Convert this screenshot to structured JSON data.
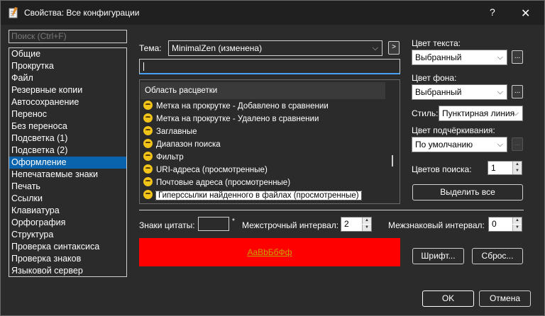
{
  "window": {
    "title": "Свойства: Все конфигурации",
    "help": "?",
    "close": "✕"
  },
  "search": {
    "placeholder": "Поиск (Ctrl+F)"
  },
  "nav": {
    "items": [
      "Общие",
      "Прокрутка",
      "Файл",
      "Резервные копии",
      "Автосохранение",
      "Перенос",
      "Без переноса",
      "Подсветка (1)",
      "Подсветка (2)",
      "Оформление",
      "Непечатаемые знаки",
      "Печать",
      "Ссылки",
      "Клавиатура",
      "Орфография",
      "Структура",
      "Проверка синтаксиса",
      "Проверка знаков",
      "Языковой сервер"
    ],
    "selected_index": 9
  },
  "theme": {
    "label": "Тема:",
    "value": "MinimalZen (изменена)",
    "arrow_button": ">"
  },
  "filter_input": {
    "value": ""
  },
  "color_list": {
    "header": "Область расцветки",
    "items": [
      "Метка на прокрутке - Добавлено в сравнении",
      "Метка на прокрутке - Удалено в сравнении",
      "Заглавные",
      "Диапазон поиска",
      "Фильтр",
      "URI-адреса (просмотренные)",
      "Почтовые адреса (просмотренные)",
      "Гиперссылки найденного в файлах (просмотренные)"
    ],
    "selected_index": 7
  },
  "right": {
    "text_color_label": "Цвет текста:",
    "text_color_value": "Выбранный",
    "bg_color_label": "Цвет фона:",
    "bg_color_value": "Выбранный",
    "ellipsis": "...",
    "style_label": "Стиль:",
    "style_value": "Пунктирная линия",
    "underline_label": "Цвет подчёркивания:",
    "underline_value": "По умолчанию",
    "search_colors_label": "Цветов поиска:",
    "search_colors_value": "1",
    "select_all": "Выделить все"
  },
  "bottom_row": {
    "quote_label": "Знаки цитаты:",
    "quote_star": "*",
    "line_spacing_label": "Межстрочный интервал:",
    "line_spacing_value": "2",
    "char_spacing_label": "Межзнаковый интервал:",
    "char_spacing_value": "0"
  },
  "preview": {
    "text": "AaBbБбФф",
    "bg_color": "#ff0000",
    "text_color": "#c9a000"
  },
  "buttons": {
    "font": "Шрифт...",
    "reset": "Сброс...",
    "ok": "OK",
    "cancel": "Отмена"
  }
}
